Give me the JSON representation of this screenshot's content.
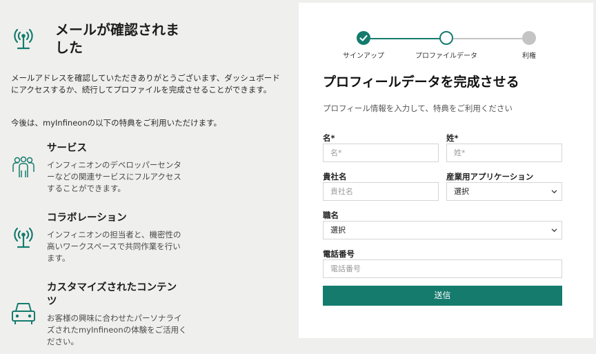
{
  "colors": {
    "accent": "#147b6d",
    "step_inactive": "#c4c4c4",
    "background": "#efefed"
  },
  "left": {
    "title": "メールが確認されました",
    "title_line1": "メールが確認されま",
    "title_line2": "した",
    "intro_line1": "メールアドレスを確認していただきありがとうございます、ダッシュボード",
    "intro_line2": "にアクセスするか、続行してプロファイルを完成させることができます。",
    "benefits_lead": "今後は、myInfineonの以下の特典をご利用いただけます。",
    "benefits": [
      {
        "icon": "people-group-icon",
        "title": "サービス",
        "desc_lines": [
          "インフィニオンのデベロッパーセンタ",
          "ーなどの関連サービスにフルアクセス",
          "することができます。"
        ]
      },
      {
        "icon": "broadcast-antenna-icon",
        "title": "コラボレーション",
        "desc_lines": [
          "インフィニオンの担当者と、機密性の",
          "高いワークスペースで共同作業を行い",
          "ます。"
        ]
      },
      {
        "icon": "car-icon",
        "title_lines": [
          "カスタマイズされたコンテン",
          "ツ"
        ],
        "desc_lines": [
          "お客様の興味に合わせたパーソナライ",
          "ズされたmyInfineonの体験をご活用く",
          "ださい。"
        ]
      }
    ]
  },
  "stepper": {
    "steps": [
      {
        "label": "サインアップ",
        "state": "complete"
      },
      {
        "label": "プロファイルデータ",
        "state": "current"
      },
      {
        "label": "利権",
        "state": "upcoming"
      }
    ]
  },
  "form": {
    "title": "プロフィールデータを完成させる",
    "subtitle": "プロフィール情報を入力して、特典をご利用ください",
    "first_name": {
      "label": "名*",
      "placeholder": "名*"
    },
    "last_name": {
      "label": "姓*",
      "placeholder": "姓*"
    },
    "company": {
      "label": "貴社名",
      "placeholder": "貴社名"
    },
    "industry": {
      "label": "産業用アプリケーション",
      "value": "選択"
    },
    "job_title": {
      "label": "職名",
      "value": "選択"
    },
    "phone": {
      "label": "電話番号",
      "placeholder": "電話番号"
    },
    "submit_label": "送信"
  }
}
